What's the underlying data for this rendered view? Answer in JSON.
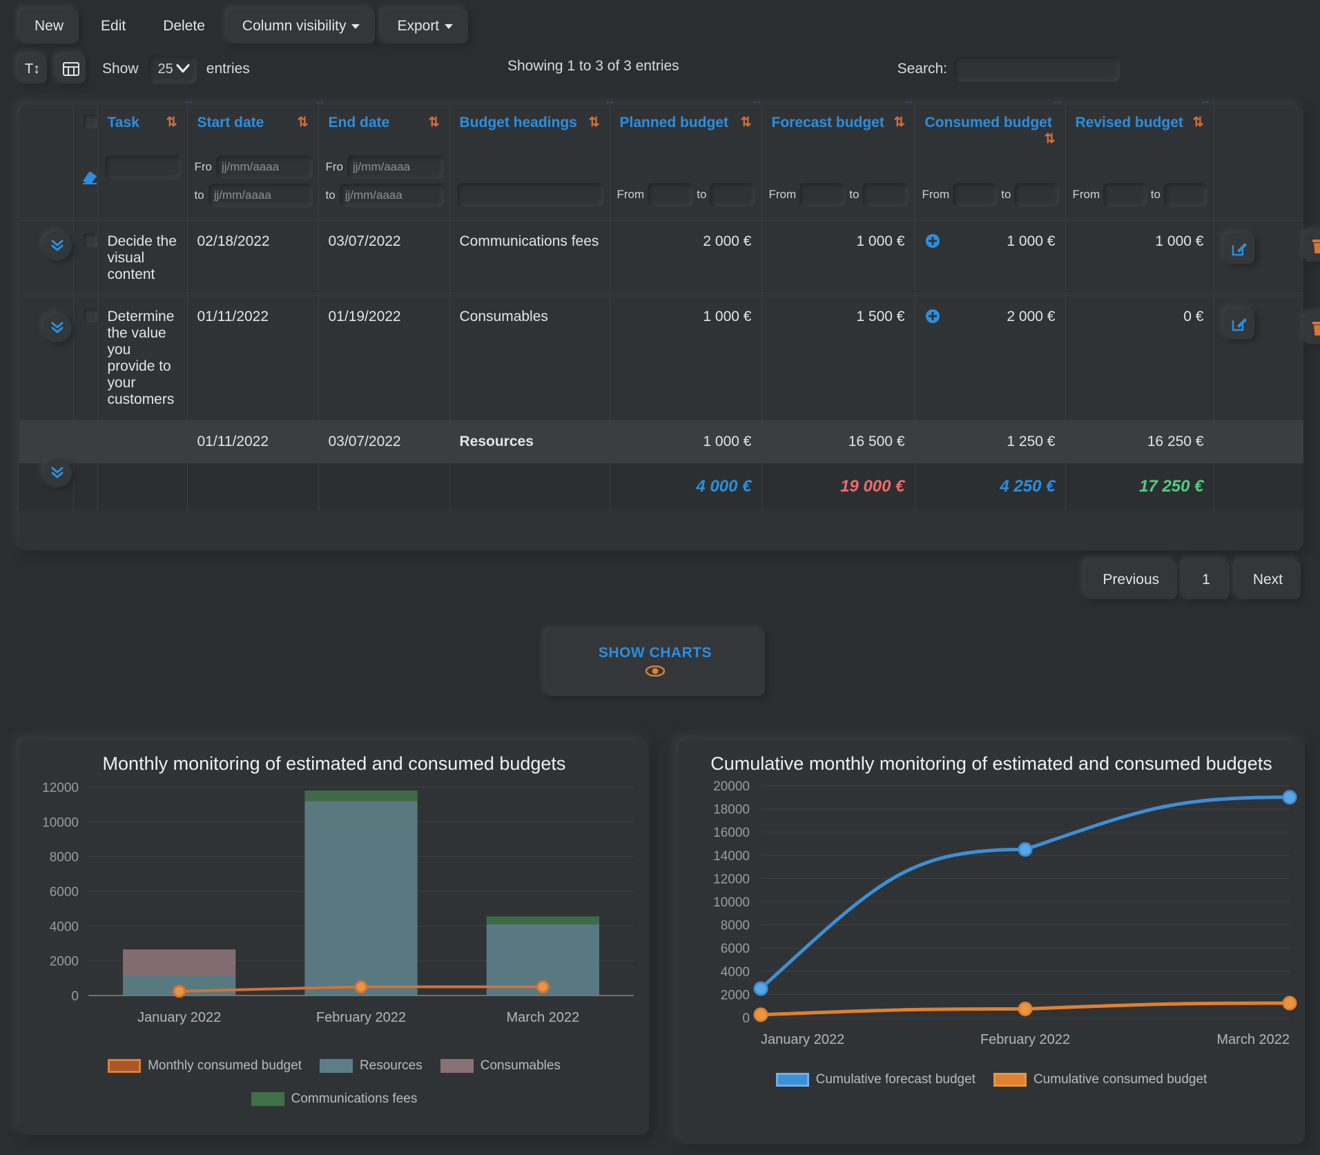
{
  "toolbar": {
    "new": "New",
    "edit": "Edit",
    "delete": "Delete",
    "column_visibility": "Column visibility",
    "export": "Export",
    "text_size_icon": "T↕",
    "table_icon": "▦",
    "show_label": "Show",
    "entries_value": "25",
    "entries_label": "entries",
    "showing_info": "Showing 1 to 3 of 3 entries",
    "search_label": "Search:",
    "search_value": ""
  },
  "table": {
    "columns": [
      "Task",
      "Start date",
      "End date",
      "Budget headings",
      "Planned budget",
      "Forecast budget",
      "Consumed budget",
      "Revised budget"
    ],
    "sort_icon": "⇅",
    "filters": {
      "date_from_label": "Fro",
      "date_to_label": "to",
      "date_placeholder": "jj/mm/aaaa",
      "num_from_label": "From",
      "num_to_label": "to",
      "clear_icon": "eraser-icon",
      "task_value": "",
      "headings_value": ""
    },
    "rows": [
      {
        "task": "Decide the visual content",
        "start": "02/18/2022",
        "end": "03/07/2022",
        "heading": "Communications fees",
        "planned": "2 000 €",
        "forecast": "1 000 €",
        "consumed": "1 000 €",
        "revised": "1 000 €",
        "has_add": true,
        "bold_heading": false
      },
      {
        "task": "Determine the value you provide to your customers",
        "start": "01/11/2022",
        "end": "01/19/2022",
        "heading": "Consumables",
        "planned": "1 000 €",
        "forecast": "1 500 €",
        "consumed": "2 000 €",
        "revised": "0 €",
        "has_add": true,
        "bold_heading": false
      },
      {
        "task": "",
        "start": "01/11/2022",
        "end": "03/07/2022",
        "heading": "Resources",
        "planned": "1 000 €",
        "forecast": "16 500 €",
        "consumed": "1 250 €",
        "revised": "16 250 €",
        "has_add": false,
        "bold_heading": true
      }
    ],
    "totals": {
      "planned": "4 000 €",
      "forecast": "19 000 €",
      "consumed": "4 250 €",
      "revised": "17 250 €"
    },
    "row_actions": {
      "edit_icon": "edit-pencil-icon",
      "delete_icon": "trash-icon"
    },
    "expand_icon": "chevron-double-down-icon",
    "add_icon": "plus-circle-icon"
  },
  "pagination": {
    "previous": "Previous",
    "page": "1",
    "next": "Next"
  },
  "show_charts": {
    "label": "SHOW CHARTS",
    "icon": "eye-icon"
  },
  "colors": {
    "accent_blue": "#2a8fe0",
    "orange": "#d4703a",
    "red": "#ef6a6a",
    "green": "#4fcf7f",
    "resources": "#5c7f87",
    "consumables": "#8a7176",
    "communications": "#3f7046"
  },
  "chart_data": [
    {
      "type": "bar",
      "title": "Monthly monitoring of estimated and consumed budgets",
      "categories": [
        "January 2022",
        "February 2022",
        "March 2022"
      ],
      "series": [
        {
          "name": "Resources",
          "values": [
            1150,
            11200,
            4100
          ],
          "color": "#5c7f87",
          "kind": "bar"
        },
        {
          "name": "Consumables",
          "values": [
            1500,
            0,
            0
          ],
          "color": "#8a7176",
          "kind": "bar"
        },
        {
          "name": "Communications fees",
          "values": [
            0,
            600,
            450
          ],
          "color": "#3f7046",
          "kind": "bar"
        },
        {
          "name": "Monthly consumed budget",
          "values": [
            250,
            500,
            500
          ],
          "color": "#d4703a",
          "kind": "line"
        }
      ],
      "legend": [
        "Monthly consumed budget",
        "Resources",
        "Consumables",
        "Communications fees"
      ],
      "ylim": [
        0,
        12000
      ],
      "yticks": [
        0,
        2000,
        4000,
        6000,
        8000,
        10000,
        12000
      ],
      "xlabel": "",
      "ylabel": "",
      "grid": true,
      "legend_position": "bottom"
    },
    {
      "type": "line",
      "title": "Cumulative monthly monitoring of estimated and consumed budgets",
      "categories": [
        "January 2022",
        "February 2022",
        "March 2022"
      ],
      "series": [
        {
          "name": "Cumulative forecast budget",
          "values": [
            2500,
            14500,
            19000
          ],
          "color": "#3d8fd6"
        },
        {
          "name": "Cumulative consumed budget",
          "values": [
            250,
            750,
            1250
          ],
          "color": "#e08030"
        }
      ],
      "legend": [
        "Cumulative forecast budget",
        "Cumulative consumed budget"
      ],
      "ylim": [
        0,
        20000
      ],
      "yticks": [
        0,
        2000,
        4000,
        6000,
        8000,
        10000,
        12000,
        14000,
        16000,
        18000,
        20000
      ],
      "xlabel": "",
      "ylabel": "",
      "grid": true,
      "legend_position": "bottom"
    }
  ]
}
